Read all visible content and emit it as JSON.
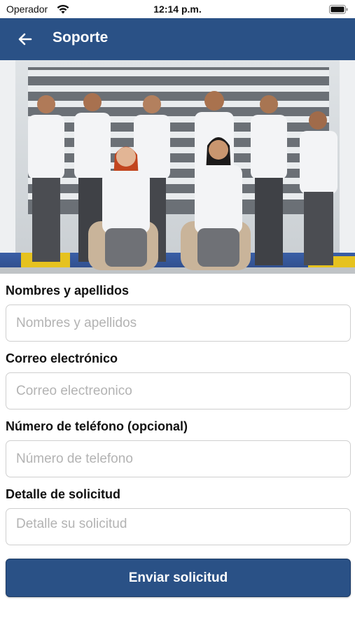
{
  "status_bar": {
    "carrier": "Operador",
    "time": "12:14 p.m.",
    "icons": [
      "wifi-icon",
      "battery-icon"
    ]
  },
  "header": {
    "title": "Soporte",
    "back_icon": "arrow-left-icon",
    "background_color": "#2a5186"
  },
  "hero_image": {
    "description_icon": "team-photo"
  },
  "form": {
    "fields": [
      {
        "label": "Nombres y apellidos",
        "placeholder": "Nombres y apellidos",
        "value": ""
      },
      {
        "label": "Correo electrónico",
        "placeholder": "Correo electreonico",
        "value": ""
      },
      {
        "label": "Número de teléfono (opcional)",
        "placeholder": "Número de telefono",
        "value": ""
      },
      {
        "label": "Detalle de solicitud",
        "placeholder": "Detalle su solicitud",
        "value": ""
      }
    ],
    "submit_label": "Enviar solicitud",
    "accent_color": "#2a5186"
  }
}
